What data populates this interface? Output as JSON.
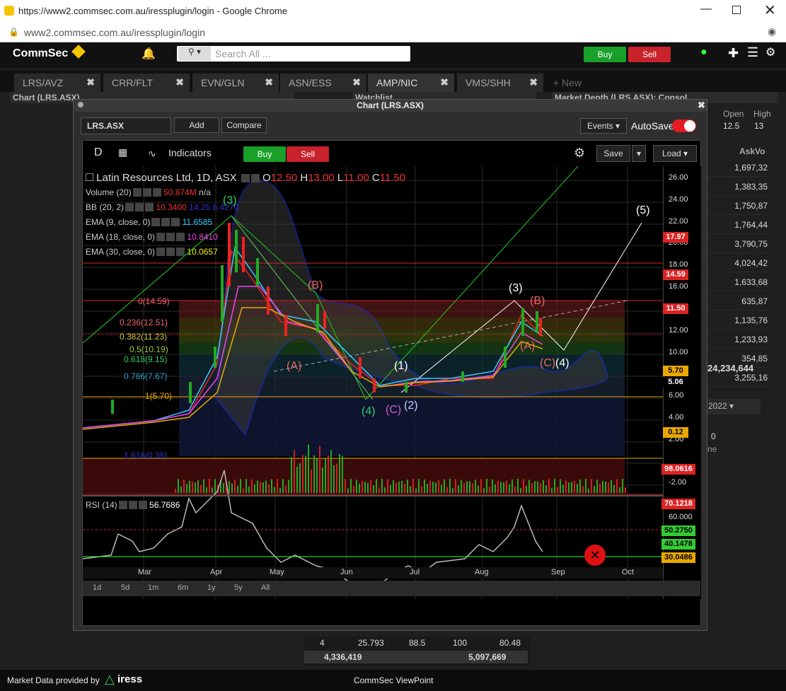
{
  "browser": {
    "title": "https://www2.commsec.com.au/iressplugin/login - Google Chrome",
    "url": "www2.commsec.com.au/iressplugin/login"
  },
  "app": {
    "brand": "CommSec",
    "search_placeholder": "Search All ...",
    "buy": "Buy",
    "sell": "Sell"
  },
  "tabs": [
    "LRS/AVZ",
    "CRR/FLT",
    "EVN/GLN",
    "ASN/ESS",
    "AMP/NIC",
    "VMS/SHH",
    "New"
  ],
  "panels": {
    "chart": "Chart (LRS.ASX)",
    "watchlist": "Watchlist",
    "depth": "Market Depth (LRS.ASX): Consol...",
    "open_label": "Open",
    "high_label": "High",
    "open": "12.5",
    "high": "13",
    "askvol_label": "AskVo",
    "askvols": [
      "1,697,32",
      "1,383,35",
      "1,750,87",
      "1,764,44",
      "3,790,75",
      "4,024,42",
      "1,633,68",
      "635,87",
      "1,135,76",
      "1,233,93",
      "354,85",
      "3,255,16"
    ],
    "total": "24,234,644",
    "year": "2022",
    "zero": "0",
    "ne": "ne"
  },
  "bottom": {
    "row": [
      "4",
      "25.793",
      "88.5",
      "100",
      "80.48"
    ],
    "left_total": "4,336,419",
    "right_total": "5,097,669"
  },
  "window": {
    "title": "Chart (LRS.ASX)",
    "symbol": "LRS.ASX",
    "add": "Add",
    "compare": "Compare",
    "events": "Events",
    "autosave": "AutoSave",
    "d": "D",
    "indicators": "Indicators",
    "buy": "Buy",
    "sell": "Sell",
    "save": "Save",
    "load": "Load"
  },
  "legend": {
    "name": "Latin Resources Ltd, 1D, ASX",
    "o": "12.50",
    "h": "13.00",
    "l": "11.00",
    "c": "11.50",
    "volume": "Volume (20)",
    "volume_val": "50.874M",
    "na": "n/a",
    "bb": "BB (20, 2)",
    "bb_val": "10.3400",
    "bb_v2": "14.25",
    "bb_v3": "6.4270",
    "ema9": "EMA (9, close, 0)",
    "ema9_val": "11.6585",
    "ema18": "EMA (18, close, 0)",
    "ema18_val": "10.8410",
    "ema30": "EMA (30, close, 0)",
    "ema30_val": "10.0657",
    "rsi": "RSI (14)",
    "rsi_val": "56.7686"
  },
  "fib": [
    "0(14.59)",
    "0.236(12.51)",
    "0.382(11.23)",
    "0.5(10.19)",
    "0.618(9.15)",
    "0.786(7.67)",
    "1(5.70)",
    "1.618(0.35)"
  ],
  "price_axis": [
    "26.00",
    "24.00",
    "22.00",
    "20.00",
    "18.00",
    "16.00",
    "14.00",
    "12.00",
    "10.00",
    "8.00",
    "6.00",
    "4.00",
    "2.00",
    "-2.00"
  ],
  "price_labels": {
    "p1797": "17.97",
    "p1459": "14.59",
    "p1150": "11.50",
    "p570": "5.70",
    "p506": "5.06",
    "p012": "0.12",
    "vol": "98.0616"
  },
  "rsi_axis": {
    "r70": "70.1218",
    "r60": "60.000",
    "r50": "50.2750",
    "r40": "40.1478",
    "r30": "30.0486"
  },
  "months": [
    "Mar",
    "Apr",
    "May",
    "Jun",
    "Jul",
    "Aug",
    "Sep",
    "Oct"
  ],
  "ranges": [
    "1d",
    "5d",
    "1m",
    "6m",
    "1y",
    "5y",
    "All"
  ],
  "waves": [
    "(3)",
    "(B)",
    "(A)",
    "(4)",
    "(C)",
    "(1)",
    "(2)",
    "(3)",
    "(B)",
    "(A)",
    "(C)",
    "(4)",
    "(5)"
  ],
  "footer": {
    "provider": "Market Data provided by",
    "iress": "iress",
    "viewpoint": "CommSec ViewPoint"
  }
}
